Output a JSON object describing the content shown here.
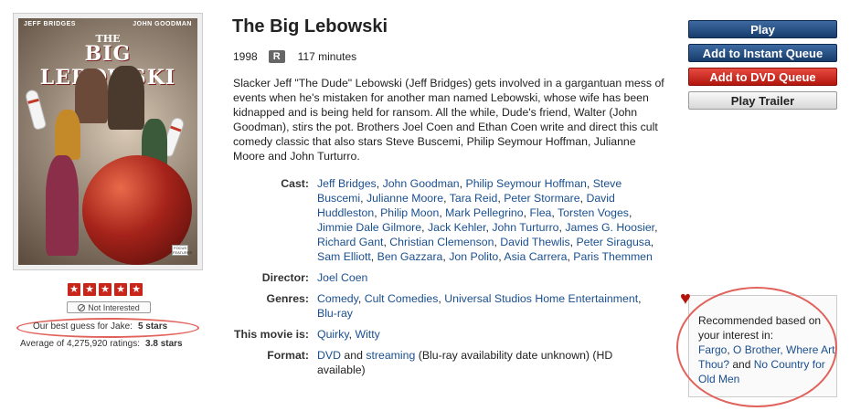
{
  "poster": {
    "actor_left": "JEFF BRIDGES",
    "actor_right": "JOHN GOODMAN",
    "title_the": "THE",
    "title_main": "BIG LEBOWSKI",
    "logo_text": "FOCUS FEATURES"
  },
  "rating": {
    "stars_count": 5,
    "star_glyph": "★",
    "not_interested_label": "Not Interested",
    "best_guess_label": "Our best guess for Jake:",
    "best_guess_value": "5 stars",
    "average_label": "Average of 4,275,920 ratings:",
    "average_value": "3.8 stars"
  },
  "movie": {
    "title": "The Big Lebowski",
    "year": "1998",
    "mpaa": "R",
    "runtime": "117 minutes",
    "synopsis": "Slacker Jeff \"The Dude\" Lebowski (Jeff Bridges) gets involved in a gargantuan mess of events when he's mistaken for another man named Lebowski, whose wife has been kidnapped and is being held for ransom. All the while, Dude's friend, Walter (John Goodman), stirs the pot. Brothers Joel Coen and Ethan Coen write and direct this cult comedy classic that also stars Steve Buscemi, Philip Seymour Hoffman, Julianne Moore and John Turturro."
  },
  "details": {
    "cast_label": "Cast:",
    "cast": [
      "Jeff Bridges",
      "John Goodman",
      "Philip Seymour Hoffman",
      "Steve Buscemi",
      "Julianne Moore",
      "Tara Reid",
      "Peter Stormare",
      "David Huddleston",
      "Philip Moon",
      "Mark Pellegrino",
      "Flea",
      "Torsten Voges",
      "Jimmie Dale Gilmore",
      "Jack Kehler",
      "John Turturro",
      "James G. Hoosier",
      "Richard Gant",
      "Christian Clemenson",
      "David Thewlis",
      "Peter Siragusa",
      "Sam Elliott",
      "Ben Gazzara",
      "Jon Polito",
      "Asia Carrera",
      "Paris Themmen"
    ],
    "director_label": "Director:",
    "director": "Joel Coen",
    "genres_label": "Genres:",
    "genres": [
      "Comedy",
      "Cult Comedies",
      "Universal Studios Home Entertainment",
      "Blu-ray"
    ],
    "mood_label": "This movie is:",
    "moods": [
      "Quirky",
      "Witty"
    ],
    "format_label": "Format:",
    "format_dvd": "DVD",
    "format_and": " and ",
    "format_streaming": "streaming",
    "format_note": " (Blu-ray availability date unknown) (HD available)"
  },
  "buttons": {
    "play": "Play",
    "instant_queue": "Add to Instant Queue",
    "dvd_queue": "Add to DVD Queue",
    "trailer": "Play Trailer"
  },
  "recommendation": {
    "intro": "Recommended based on your interest in:",
    "titles": [
      "Fargo",
      "O Brother, Where Art Thou?",
      "No Country for Old Men"
    ],
    "and_word": "and",
    "heart_icon": "♥"
  },
  "colors": {
    "link": "#1a4f8f",
    "play_blue": "#173c6c",
    "dvd_red": "#b1160d",
    "annotation_red": "#e0625b"
  }
}
